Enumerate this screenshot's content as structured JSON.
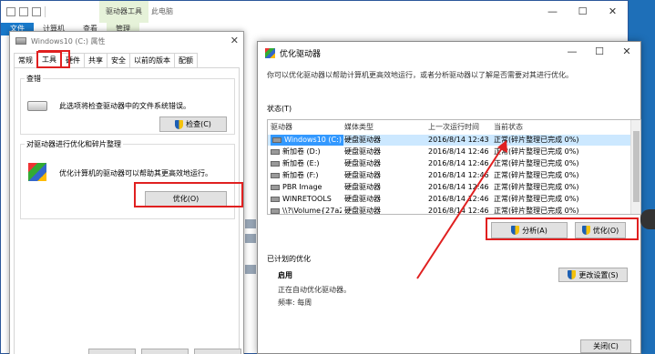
{
  "explorer": {
    "contextual_tab": "驱动器工具",
    "title": "此电脑",
    "ribbon_tabs": [
      "文件",
      "计算机",
      "查看",
      "管理"
    ],
    "controls": {
      "minimize": "—",
      "maximize": "☐",
      "close": "✕"
    }
  },
  "properties": {
    "title": "Windows10 (C:) 属性",
    "tabs": [
      "常规",
      "工具",
      "硬件",
      "共享",
      "安全",
      "以前的版本",
      "配额"
    ],
    "check_group": "查错",
    "check_desc": "此选项将检查驱动器中的文件系统错误。",
    "check_button": "检查(C)",
    "optimize_group": "对驱动器进行优化和碎片整理",
    "optimize_desc": "优化计算机的驱动器可以帮助其更高效地运行。",
    "optimize_button": "优化(O)"
  },
  "optimize_window": {
    "title": "优化驱动器",
    "description": "你可以优化驱动器以帮助计算机更高效地运行，或者分析驱动器以了解是否需要对其进行优化。",
    "status_label": "状态(T)",
    "columns": [
      "驱动器",
      "媒体类型",
      "上一次运行时间",
      "当前状态"
    ],
    "rows": [
      {
        "drive": "Windows10 (C:)",
        "media": "硬盘驱动器",
        "last_run": "2016/8/14 12:43",
        "status": "正常(碎片整理已完成 0%)"
      },
      {
        "drive": "新加卷 (D:)",
        "media": "硬盘驱动器",
        "last_run": "2016/8/14 12:46",
        "status": "正常(碎片整理已完成 0%)"
      },
      {
        "drive": "新加卷 (E:)",
        "media": "硬盘驱动器",
        "last_run": "2016/8/14 12:46",
        "status": "正常(碎片整理已完成 0%)"
      },
      {
        "drive": "新加卷 (F:)",
        "media": "硬盘驱动器",
        "last_run": "2016/8/14 12:46",
        "status": "正常(碎片整理已完成 0%)"
      },
      {
        "drive": "PBR Image",
        "media": "硬盘驱动器",
        "last_run": "2016/8/14 12:46",
        "status": "正常(碎片整理已完成 0%)"
      },
      {
        "drive": "WINRETOOLS",
        "media": "硬盘驱动器",
        "last_run": "2016/8/14 12:46",
        "status": "正常(碎片整理已完成 0%)"
      },
      {
        "drive": "\\\\?\\Volume{27a2...",
        "media": "硬盘驱动器",
        "last_run": "2016/8/14 12:46",
        "status": "正常(碎片整理已完成 0%)"
      }
    ],
    "analyze_button": "分析(A)",
    "optimize_button": "优化(O)",
    "scheduled_label": "已计划的优化",
    "scheduled_state": "启用",
    "scheduled_desc": "正在自动优化驱动器。",
    "frequency": "频率: 每周",
    "change_settings_button": "更改设置(S)",
    "close_button": "关闭(C)"
  },
  "colors": {
    "accent": "#1979ca",
    "highlight": "#e02020",
    "selection": "#3399ff"
  }
}
